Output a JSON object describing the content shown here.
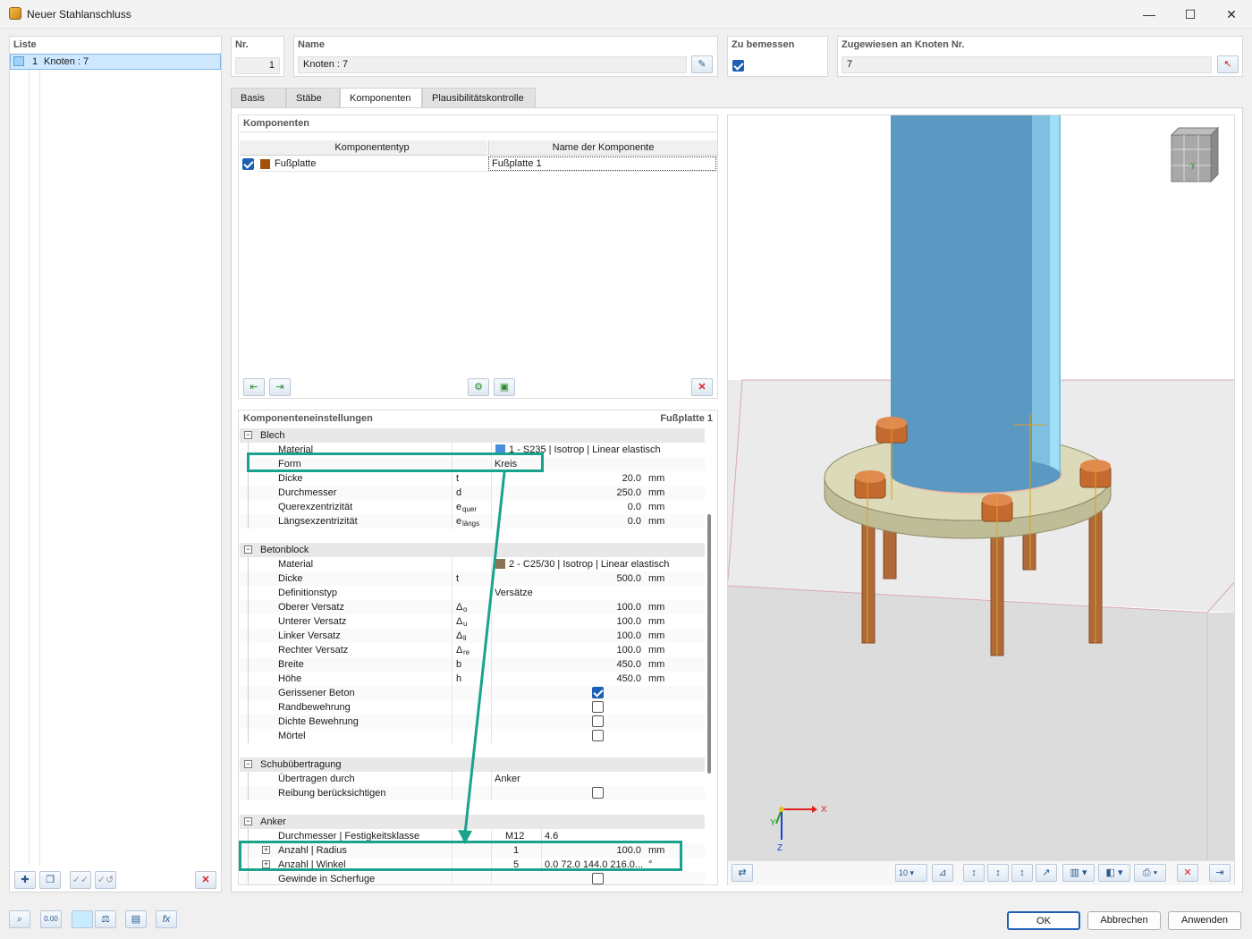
{
  "window": {
    "title": "Neuer Stahlanschluss",
    "minimize": "—",
    "maximize": "☐",
    "close": "✕"
  },
  "list": {
    "header": "Liste",
    "items": [
      {
        "nr": "1",
        "label": "Knoten : 7"
      }
    ]
  },
  "header": {
    "nr_label": "Nr.",
    "nr_value": "1",
    "name_label": "Name",
    "name_value": "Knoten : 7",
    "to_design_label": "Zu bemessen",
    "assigned_label": "Zugewiesen an Knoten Nr.",
    "assigned_value": "7"
  },
  "tabs": [
    {
      "label": "Basis",
      "active": false
    },
    {
      "label": "Stäbe",
      "active": false
    },
    {
      "label": "Komponenten",
      "active": true
    },
    {
      "label": "Plausibilitätskontrolle",
      "active": false
    }
  ],
  "components": {
    "title": "Komponenten",
    "col_type": "Komponententyp",
    "col_name": "Name der Komponente",
    "rows": [
      {
        "type": "Fußplatte",
        "name": "Fußplatte 1",
        "color": "#a0520a"
      }
    ]
  },
  "settings": {
    "title": "Komponenteneinstellungen",
    "current": "Fußplatte 1",
    "sections": [
      {
        "title": "Blech",
        "rows": [
          {
            "label": "Material",
            "sym": "",
            "sym_sub": "",
            "value": "1 - S235 | Isotrop | Linear elastisch",
            "unit": "",
            "kind": "material",
            "swatch": "#4a8fdc"
          },
          {
            "label": "Form",
            "sym": "",
            "sym_sub": "",
            "value": "Kreis",
            "unit": "",
            "kind": "text"
          },
          {
            "label": "Dicke",
            "sym": "t",
            "sym_sub": "",
            "value": "20.0",
            "unit": "mm",
            "kind": "num"
          },
          {
            "label": "Durchmesser",
            "sym": "d",
            "sym_sub": "",
            "value": "250.0",
            "unit": "mm",
            "kind": "num"
          },
          {
            "label": "Querexzentrizität",
            "sym": "e",
            "sym_sub": "quer",
            "value": "0.0",
            "unit": "mm",
            "kind": "num"
          },
          {
            "label": "Längsexzentrizität",
            "sym": "e",
            "sym_sub": "längs",
            "value": "0.0",
            "unit": "mm",
            "kind": "num"
          }
        ]
      },
      {
        "title": "Betonblock",
        "rows": [
          {
            "label": "Material",
            "sym": "",
            "sym_sub": "",
            "value": "2 - C25/30 | Isotrop | Linear elastisch",
            "unit": "",
            "kind": "material",
            "swatch": "#8a7456"
          },
          {
            "label": "Dicke",
            "sym": "t",
            "sym_sub": "",
            "value": "500.0",
            "unit": "mm",
            "kind": "num"
          },
          {
            "label": "Definitionstyp",
            "sym": "",
            "sym_sub": "",
            "value": "Versätze",
            "unit": "",
            "kind": "text"
          },
          {
            "label": "Oberer Versatz",
            "sym": "Δ",
            "sym_sub": "o",
            "value": "100.0",
            "unit": "mm",
            "kind": "num"
          },
          {
            "label": "Unterer Versatz",
            "sym": "Δ",
            "sym_sub": "u",
            "value": "100.0",
            "unit": "mm",
            "kind": "num"
          },
          {
            "label": "Linker Versatz",
            "sym": "Δ",
            "sym_sub": "li",
            "value": "100.0",
            "unit": "mm",
            "kind": "num"
          },
          {
            "label": "Rechter Versatz",
            "sym": "Δ",
            "sym_sub": "re",
            "value": "100.0",
            "unit": "mm",
            "kind": "num"
          },
          {
            "label": "Breite",
            "sym": "b",
            "sym_sub": "",
            "value": "450.0",
            "unit": "mm",
            "kind": "num"
          },
          {
            "label": "Höhe",
            "sym": "h",
            "sym_sub": "",
            "value": "450.0",
            "unit": "mm",
            "kind": "num"
          },
          {
            "label": "Gerissener Beton",
            "kind": "check",
            "checked": true
          },
          {
            "label": "Randbewehrung",
            "kind": "check",
            "checked": false
          },
          {
            "label": "Dichte Bewehrung",
            "kind": "check",
            "checked": false
          },
          {
            "label": "Mörtel",
            "kind": "check",
            "checked": false
          }
        ]
      },
      {
        "title": "Schubübertragung",
        "rows": [
          {
            "label": "Übertragen durch",
            "sym": "",
            "sym_sub": "",
            "value": "Anker",
            "unit": "",
            "kind": "text"
          },
          {
            "label": "Reibung berücksichtigen",
            "kind": "check",
            "checked": false
          }
        ]
      },
      {
        "title": "Anker",
        "rows": [
          {
            "label": "Durchmesser | Festigkeitsklasse",
            "kind": "pair",
            "a": "M12",
            "b": "4.6"
          },
          {
            "label": "Anzahl | Radius",
            "kind": "pair2",
            "a": "1",
            "b": "100.0",
            "unit": "mm",
            "expand": true
          },
          {
            "label": "Anzahl | Winkel",
            "kind": "pair2",
            "a": "5",
            "b": "0.0 72.0 144.0 216.0...",
            "unit": "°",
            "expand": true
          },
          {
            "label": "Gewinde in Scherfuge",
            "kind": "check",
            "checked": false
          }
        ]
      }
    ]
  },
  "view": {
    "axis_x": "X",
    "axis_y": "Y",
    "axis_z": "Z",
    "cube_label": "-y",
    "scale_value": "10"
  },
  "buttons": {
    "ok": "OK",
    "cancel": "Abbrechen",
    "apply": "Anwenden"
  },
  "footer_icons": [
    "search-icon",
    "decimal-icon",
    "color-icon",
    "model-icon",
    "view-icon",
    "formula-icon"
  ],
  "footer_decimal": "0.00",
  "footer_formula": "fx",
  "colors": {
    "accent": "#1c5fb5",
    "highlight": "#19a38c",
    "column": "#5b98c2",
    "plate": "#dcdab8",
    "bolt": "#c46a2e",
    "delete": "#e02020"
  }
}
